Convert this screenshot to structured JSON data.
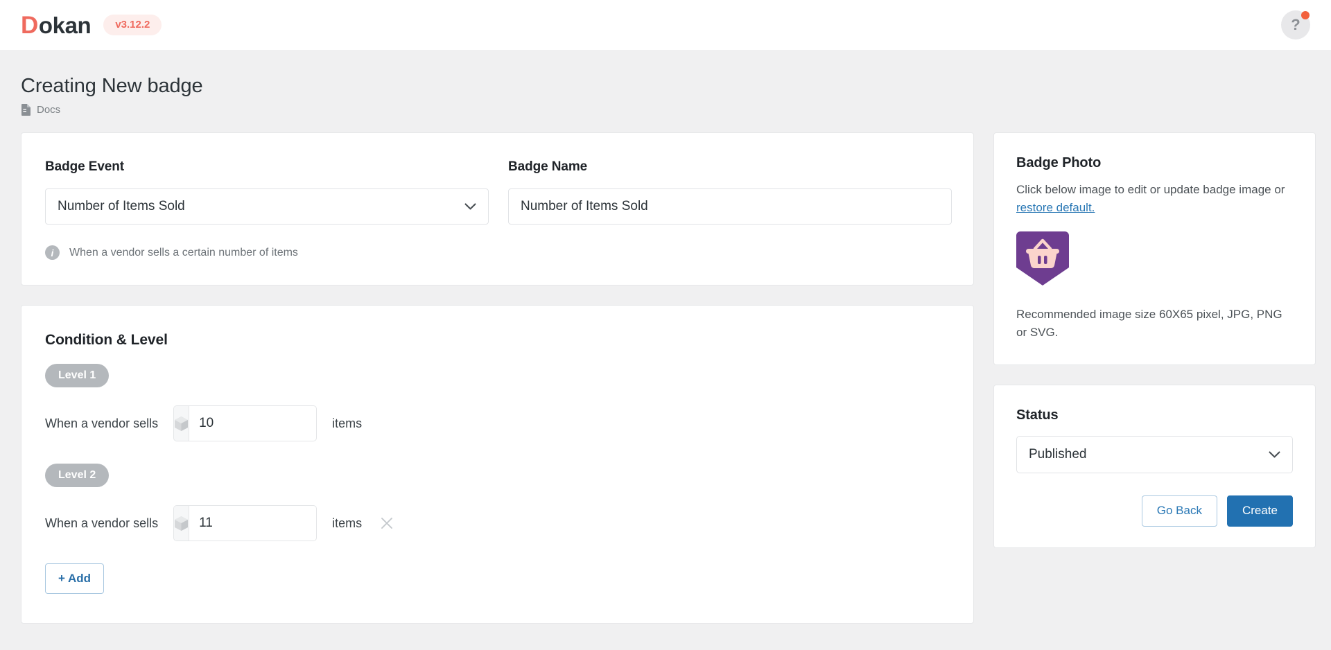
{
  "topbar": {
    "logo_d": "D",
    "logo_rest": "okan",
    "version": "v3.12.2",
    "help_label": "?"
  },
  "page": {
    "title": "Creating New badge",
    "docs_label": "Docs"
  },
  "badge_event": {
    "event_label": "Badge Event",
    "event_value": "Number of Items Sold",
    "event_hint": "When a vendor sells a certain number of items",
    "name_label": "Badge Name",
    "name_value": "Number of Items Sold",
    "name_placeholder": "Badge Name"
  },
  "condition": {
    "title": "Condition & Level",
    "levels": [
      {
        "pill": "Level 1",
        "prefix_label": "When a vendor sells",
        "value": "10",
        "unit": "items",
        "removable": false
      },
      {
        "pill": "Level 2",
        "prefix_label": "When a vendor sells",
        "value": "11",
        "unit": "items",
        "removable": true
      }
    ],
    "add_label": "+ Add"
  },
  "badge_photo": {
    "title": "Badge Photo",
    "description_prefix": "Click below image to edit or update badge image or ",
    "restore_link": "restore default.",
    "recommendation": "Recommended image size 60X65 pixel, JPG, PNG or SVG.",
    "shield_color": "#6e3d90",
    "basket_color": "#fbd4cc"
  },
  "status": {
    "title": "Status",
    "value": "Published",
    "go_back_label": "Go Back",
    "create_label": "Create"
  },
  "colors": {
    "brand": "#ef6a5e",
    "primary": "#2271b1",
    "link": "#2a78b5",
    "pill_gray": "#b4b8bc"
  }
}
